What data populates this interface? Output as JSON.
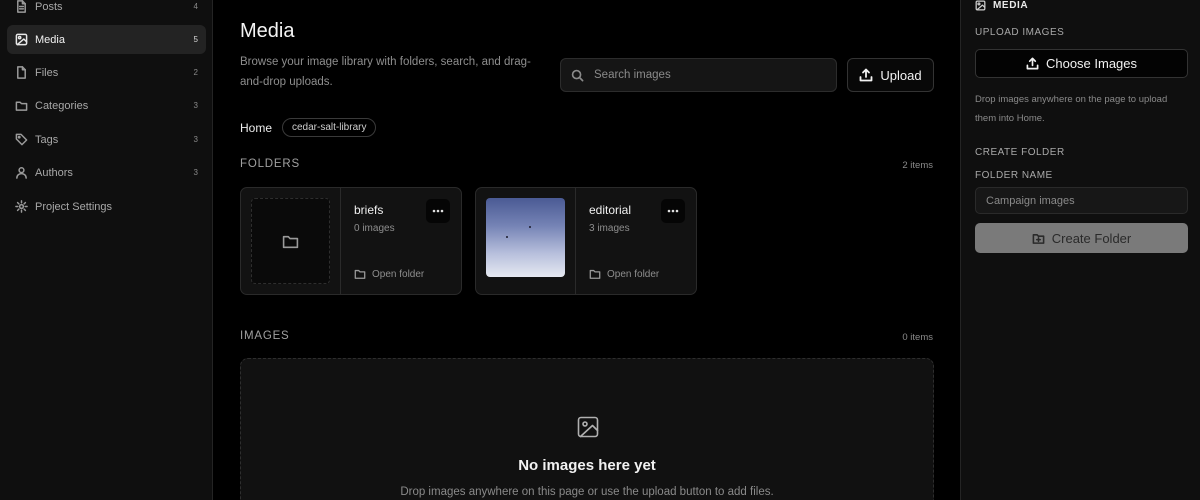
{
  "sidebar": {
    "items": [
      {
        "label": "Posts",
        "count": "4",
        "icon": "document-icon"
      },
      {
        "label": "Media",
        "count": "5",
        "icon": "image-icon",
        "active": true
      },
      {
        "label": "Files",
        "count": "2",
        "icon": "file-icon"
      },
      {
        "label": "Categories",
        "count": "3",
        "icon": "folder-icon"
      },
      {
        "label": "Tags",
        "count": "3",
        "icon": "tag-icon"
      },
      {
        "label": "Authors",
        "count": "3",
        "icon": "user-icon"
      },
      {
        "label": "Project Settings",
        "count": "",
        "icon": "gear-icon"
      }
    ]
  },
  "main": {
    "title": "Media",
    "description": "Browse your image library with folders, search, and drag-and-drop uploads.",
    "search": {
      "placeholder": "Search images",
      "value": ""
    },
    "upload_label": "Upload",
    "breadcrumb": {
      "home": "Home",
      "chip": "cedar-salt-library"
    },
    "folders_section": {
      "label": "FOLDERS",
      "count": "2 items",
      "folders": [
        {
          "name": "briefs",
          "meta": "0 images",
          "open_label": "Open folder",
          "thumbnail": "empty"
        },
        {
          "name": "editorial",
          "meta": "3 images",
          "open_label": "Open folder",
          "thumbnail": "image"
        }
      ]
    },
    "images_section": {
      "label": "IMAGES",
      "count": "0 items",
      "empty_title": "No images here yet",
      "empty_desc": "Drop images anywhere on this page or use the upload button to add files."
    }
  },
  "panel": {
    "heading": "MEDIA",
    "upload_label": "UPLOAD IMAGES",
    "choose_label": "Choose Images",
    "help": "Drop images anywhere on the page to upload them into Home.",
    "create_folder_label": "CREATE FOLDER",
    "folder_name_label": "FOLDER NAME",
    "folder_name_placeholder": "Campaign images",
    "create_button": "Create Folder"
  },
  "colors": {
    "background": "#000000",
    "sidebar_bg": "#0f0f0f",
    "active_item_bg": "#232323",
    "disabled_button": "#7a7a7a"
  }
}
